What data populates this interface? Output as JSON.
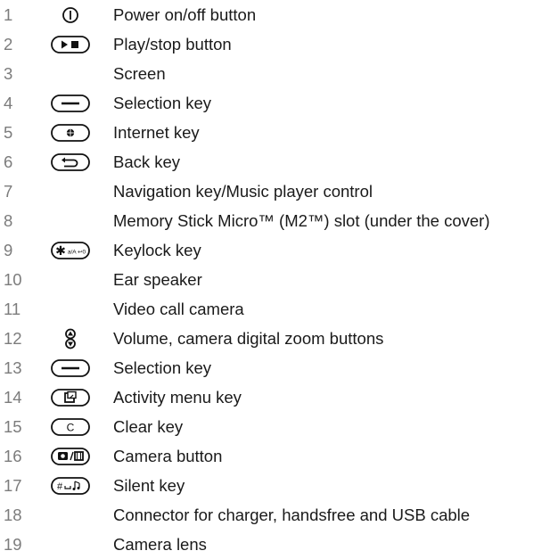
{
  "legend": {
    "items": [
      {
        "num": "1",
        "icon": "power-icon",
        "label": "Power on/off button"
      },
      {
        "num": "2",
        "icon": "play-stop-icon",
        "label": "Play/stop button"
      },
      {
        "num": "3",
        "icon": "",
        "label": "Screen"
      },
      {
        "num": "4",
        "icon": "selection-key-icon",
        "label": "Selection key"
      },
      {
        "num": "5",
        "icon": "internet-key-icon",
        "label": "Internet key"
      },
      {
        "num": "6",
        "icon": "back-key-icon",
        "label": "Back key"
      },
      {
        "num": "7",
        "icon": "",
        "label": "Navigation key/Music player control"
      },
      {
        "num": "8",
        "icon": "",
        "label": "Memory Stick Micro™ (M2™) slot (under the cover)"
      },
      {
        "num": "9",
        "icon": "keylock-key-icon",
        "label": "Keylock key",
        "icon_text": "a/A ↩0"
      },
      {
        "num": "10",
        "icon": "",
        "label": "Ear speaker"
      },
      {
        "num": "11",
        "icon": "",
        "label": "Video call camera"
      },
      {
        "num": "12",
        "icon": "volume-updown-icon",
        "label": "Volume, camera digital zoom buttons"
      },
      {
        "num": "13",
        "icon": "selection-key-icon",
        "label": "Selection key"
      },
      {
        "num": "14",
        "icon": "activity-menu-key-icon",
        "label": "Activity menu key"
      },
      {
        "num": "15",
        "icon": "clear-key-icon",
        "label": "Clear key",
        "icon_text": "C"
      },
      {
        "num": "16",
        "icon": "camera-button-icon",
        "label": "Camera button"
      },
      {
        "num": "17",
        "icon": "silent-key-icon",
        "label": "Silent key"
      },
      {
        "num": "18",
        "icon": "",
        "label": "Connector for charger, handsfree and USB cable"
      },
      {
        "num": "19",
        "icon": "",
        "label": "Camera lens"
      }
    ]
  }
}
